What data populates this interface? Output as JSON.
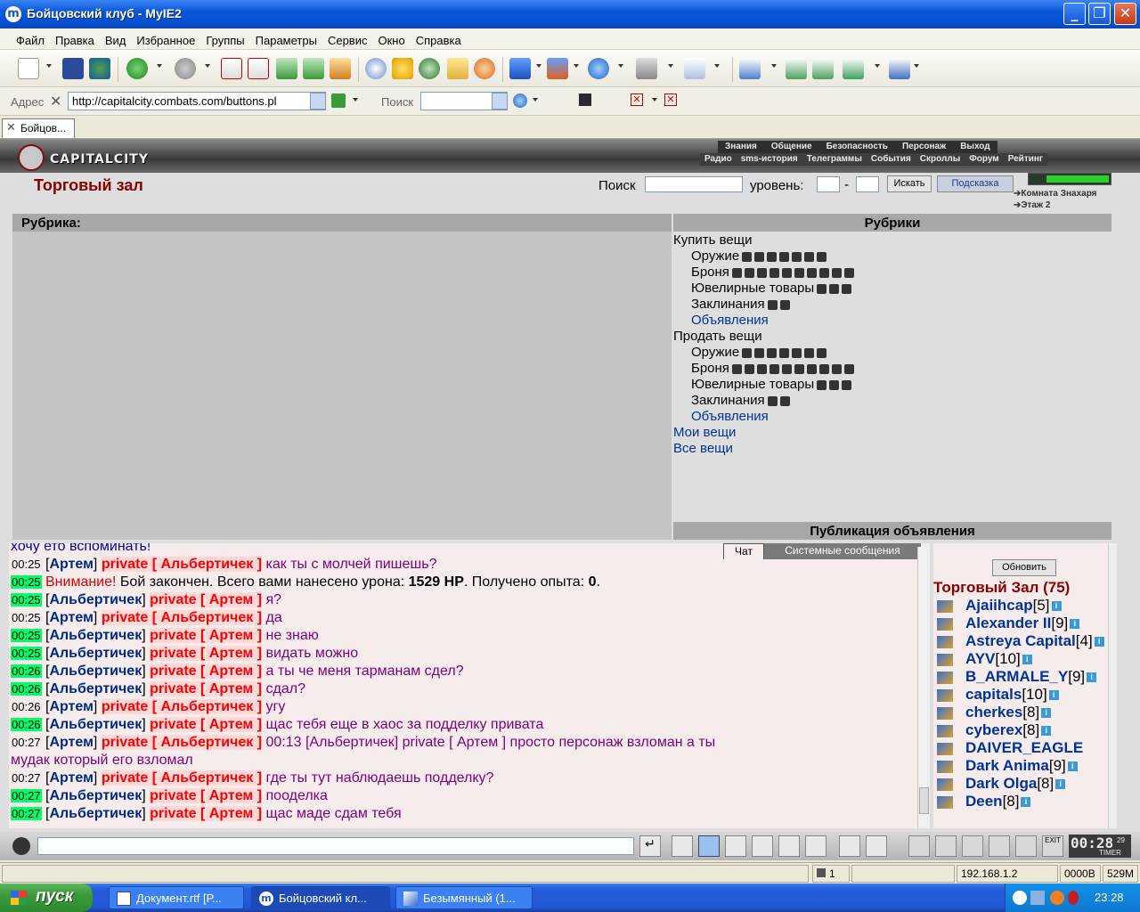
{
  "window": {
    "title": "Бойцовский клуб - MyIE2"
  },
  "menu": [
    "Файл",
    "Правка",
    "Вид",
    "Избранное",
    "Группы",
    "Параметры",
    "Сервис",
    "Окно",
    "Справка"
  ],
  "address": {
    "label": "Адрес",
    "url": "http://capitalcity.combats.com/buttons.pl",
    "search_label": "Поиск"
  },
  "tab": {
    "label": "Бойцов..."
  },
  "site": {
    "logo": "CAPITALCITY",
    "nav_top": [
      "Знания",
      "Общение",
      "Безопасность",
      "Персонаж",
      "Выход"
    ],
    "nav_bottom": [
      "Радио",
      "sms-история",
      "Телеграммы",
      "События",
      "Скроллы",
      "Форум",
      "Рейтинг"
    ],
    "page_title": "Торговый зал",
    "search_label": "Поиск",
    "level_label": "уровень:",
    "level_dash": "-",
    "search_button": "Искать",
    "hint_button": "Подсказка",
    "room_link1": "Комната Знахаря",
    "room_link2": "Этаж 2"
  },
  "left_panel": {
    "header": "Рубрика:"
  },
  "right_panel": {
    "header": "Рубрики",
    "footer": "Публикация объявления",
    "buy": "Купить вещи",
    "sell": "Продать вещи",
    "weapons": "Оружие",
    "armor": "Броня",
    "jewelry": "Ювелирные товары",
    "spells": "Заклинания",
    "ads": "Объявления",
    "my_items": "Мои вещи",
    "all_items": "Все вещи"
  },
  "chat": {
    "tab_chat": "Чат",
    "tab_system": "Системные сообщения",
    "first_line": "хочу ето вспоминать!",
    "lines": [
      {
        "time": "00:25",
        "green": false,
        "from": "Артем",
        "to": "Альбертичек",
        "text": "как ты с молчей пишешь?"
      },
      {
        "time": "00:25",
        "green": true,
        "system": true,
        "warn": "Внимание!",
        "text": "Бой закончен. Всего вами нанесено урона:",
        "hp": "1529 HP",
        "text2": ". Получено опыта:",
        "exp": "0",
        "text3": "."
      },
      {
        "time": "00:25",
        "green": true,
        "from": "Альбертичек",
        "to": "Артем",
        "text": "я?"
      },
      {
        "time": "00:25",
        "green": false,
        "from": "Артем",
        "to": "Альбертичек",
        "text": "да"
      },
      {
        "time": "00:25",
        "green": true,
        "from": "Альбертичек",
        "to": "Артем",
        "text": "не знаю"
      },
      {
        "time": "00:25",
        "green": true,
        "from": "Альбертичек",
        "to": "Артем",
        "text": "видать можно"
      },
      {
        "time": "00:26",
        "green": true,
        "from": "Альбертичек",
        "to": "Артем",
        "text": "а ты че меня тарманам сдел?"
      },
      {
        "time": "00:26",
        "green": true,
        "from": "Альбертичек",
        "to": "Артем",
        "text": "сдал?"
      },
      {
        "time": "00:26",
        "green": false,
        "from": "Артем",
        "to": "Альбертичек",
        "text": "угу"
      },
      {
        "time": "00:26",
        "green": true,
        "from": "Альбертичек",
        "to": "Артем",
        "text": "щас тебя еще в хаос за подделку привата"
      },
      {
        "time": "00:27",
        "green": false,
        "from": "Артем",
        "to": "Альбертичек",
        "text": "00:13 [Альбертичек] private [ Артем ] просто персонаж взломан а ты"
      },
      {
        "wrap": true,
        "text": "мудак который его взломал"
      },
      {
        "time": "00:27",
        "green": false,
        "from": "Артем",
        "to": "Альбертичек",
        "text": "где ты тут наблюдаешь подделку?"
      },
      {
        "time": "00:27",
        "green": true,
        "from": "Альбертичек",
        "to": "Артем",
        "text": "пооделка"
      },
      {
        "time": "00:27",
        "green": true,
        "from": "Альбертичек",
        "to": "Артем",
        "text": "щас маде сдам тебя"
      }
    ],
    "private": "private"
  },
  "users": {
    "refresh": "Обновить",
    "room_title": "Торговый Зал (75)",
    "list": [
      {
        "name": "Ajaiihcap",
        "lvl": "[5]"
      },
      {
        "name": "Alexander II",
        "lvl": "[9]"
      },
      {
        "name": "Astreya Capital",
        "lvl": "[4]"
      },
      {
        "name": "AYV",
        "lvl": "[10]"
      },
      {
        "name": "B_ARMALE_Y",
        "lvl": "[9]"
      },
      {
        "name": "capitals",
        "lvl": "[10]"
      },
      {
        "name": "cherkes",
        "lvl": "[8]"
      },
      {
        "name": "cyberex",
        "lvl": "[8]"
      },
      {
        "name": "DAIVER_EAGLE",
        "lvl": ""
      },
      {
        "name": "Dark Anima",
        "lvl": "[9]"
      },
      {
        "name": "Dark Olga",
        "lvl": "[8]"
      },
      {
        "name": "Deen",
        "lvl": "[8]"
      }
    ]
  },
  "inbar": {
    "clock": "00:28",
    "clock_sec": "29",
    "timer": "TIMER",
    "exit": "EXIT"
  },
  "status": {
    "tabs": "1",
    "ip": "192.168.1.2",
    "speed": "0000B",
    "mem": "529M"
  },
  "taskbar": {
    "start": "пуск",
    "tasks": [
      "Документ.rtf [Р...",
      "Бойцовский кл...",
      "Безымянный (1..."
    ],
    "time": "23:28"
  }
}
